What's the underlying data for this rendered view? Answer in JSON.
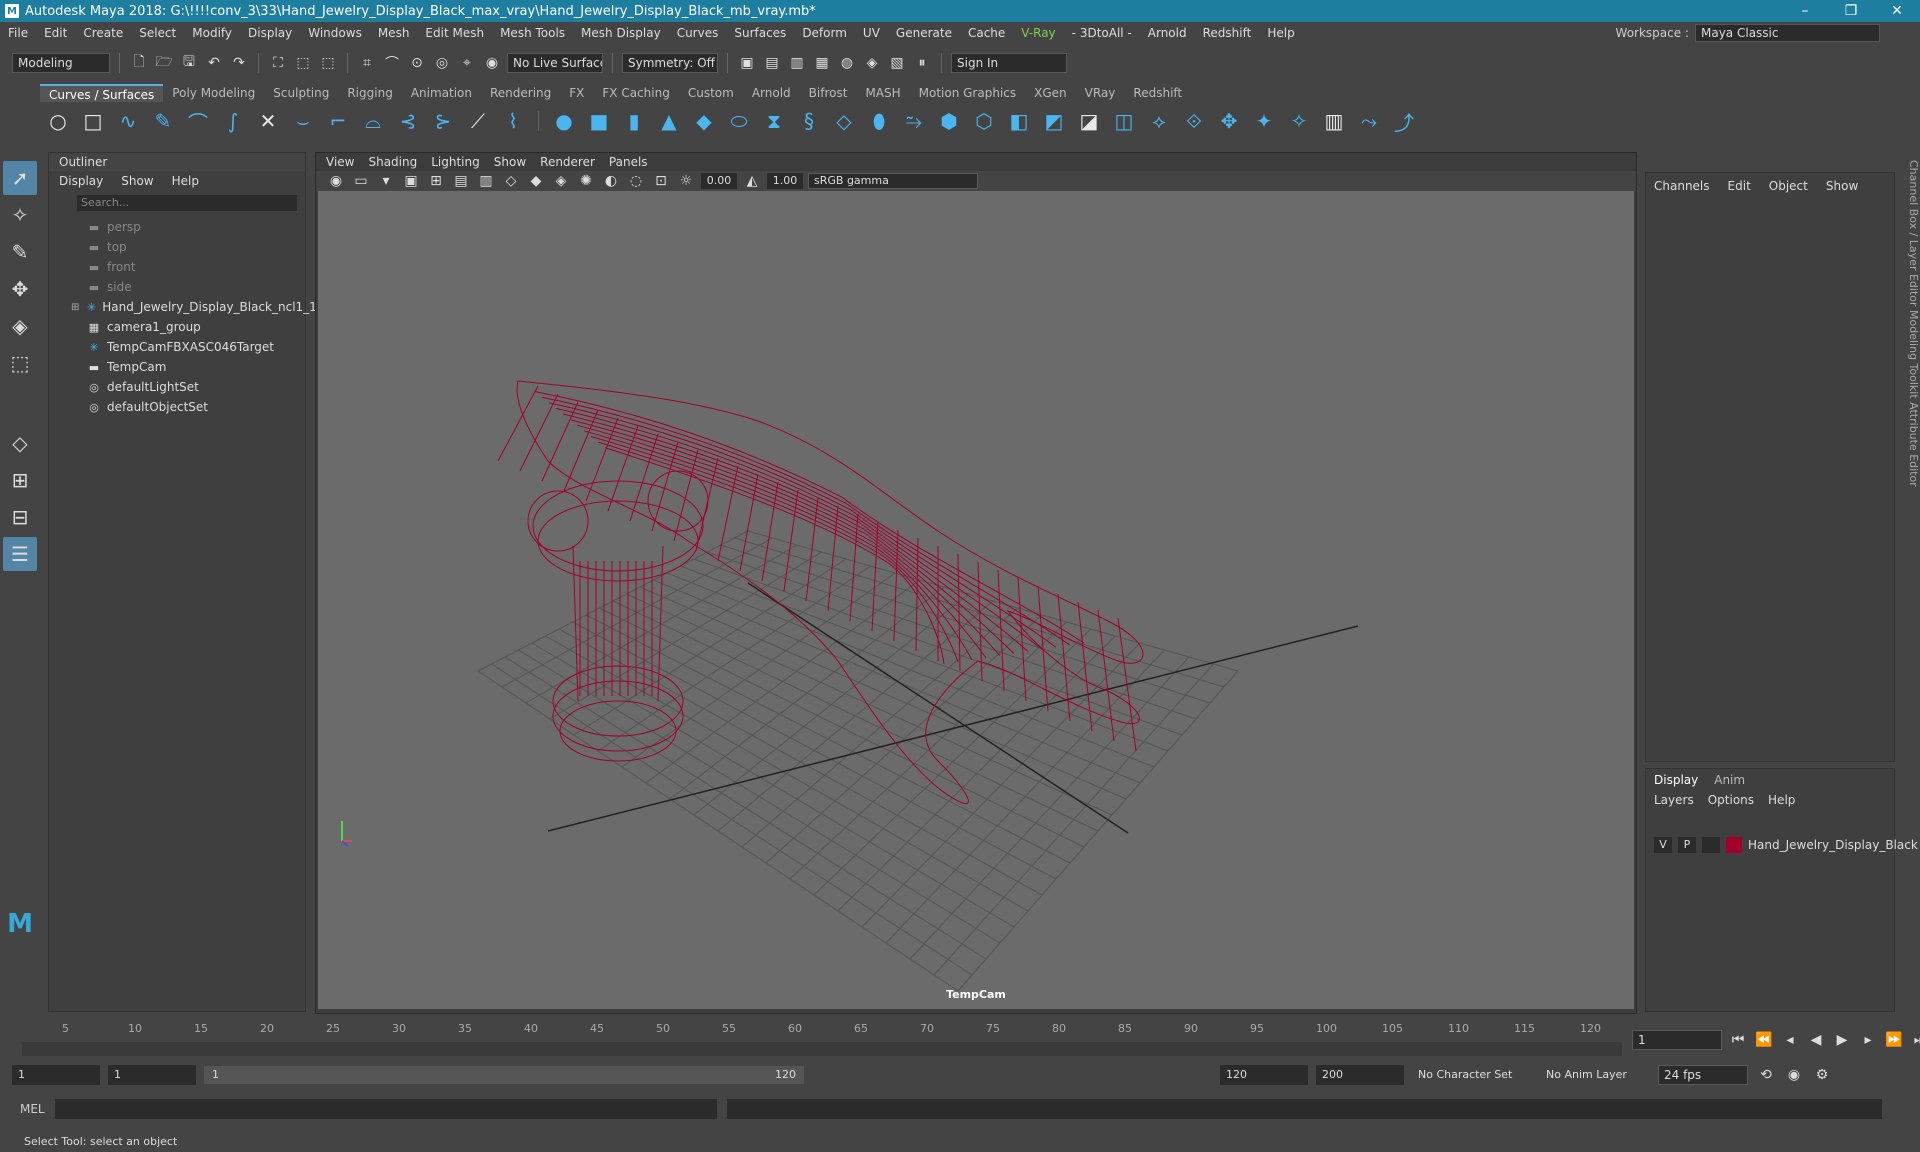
{
  "titlebar": {
    "title": "Autodesk Maya 2018: G:\\!!!!conv_3\\33\\Hand_Jewelry_Display_Black_max_vray\\Hand_Jewelry_Display_Black_mb_vray.mb*",
    "min": "–",
    "max": "❐",
    "close": "✕"
  },
  "menu": [
    "File",
    "Edit",
    "Create",
    "Select",
    "Modify",
    "Display",
    "Windows",
    "Mesh",
    "Edit Mesh",
    "Mesh Tools",
    "Mesh Display",
    "Curves",
    "Surfaces",
    "Deform",
    "UV",
    "Generate",
    "Cache",
    "V-Ray",
    "- 3DtoAll -",
    "Arnold",
    "Redshift",
    "Help"
  ],
  "workspace": {
    "label": "Workspace :",
    "value": "Maya Classic"
  },
  "statusline": {
    "mode": "Modeling",
    "live": "No Live Surface",
    "symmetry": "Symmetry: Off",
    "signin": "Sign In"
  },
  "shelf_tabs": [
    "Curves / Surfaces",
    "Poly Modeling",
    "Sculpting",
    "Rigging",
    "Animation",
    "Rendering",
    "FX",
    "FX Caching",
    "Custom",
    "Arnold",
    "Bifrost",
    "MASH",
    "Motion Graphics",
    "XGen",
    "VRay",
    "Redshift"
  ],
  "outliner": {
    "title": "Outliner",
    "menus": [
      "Display",
      "Show",
      "Help"
    ],
    "search": "Search...",
    "items": [
      {
        "label": "persp",
        "type": "cam"
      },
      {
        "label": "top",
        "type": "cam"
      },
      {
        "label": "front",
        "type": "cam"
      },
      {
        "label": "side",
        "type": "cam"
      },
      {
        "label": "Hand_Jewelry_Display_Black_ncl1_1",
        "type": "group"
      },
      {
        "label": "camera1_group",
        "type": "grp"
      },
      {
        "label": "TempCamFBXASC046Target",
        "type": "target"
      },
      {
        "label": "TempCam",
        "type": "camobj"
      },
      {
        "label": "defaultLightSet",
        "type": "set"
      },
      {
        "label": "defaultObjectSet",
        "type": "set"
      }
    ]
  },
  "viewport": {
    "menus": [
      "View",
      "Shading",
      "Lighting",
      "Show",
      "Renderer",
      "Panels"
    ],
    "exposure": "0.00",
    "gamma": "1.00",
    "colorspace": "sRGB gamma",
    "camera": "TempCam"
  },
  "channelbox": {
    "menus": [
      "Channels",
      "Edit",
      "Object",
      "Show"
    ]
  },
  "layers": {
    "tabs": [
      "Display",
      "Anim"
    ],
    "menus": [
      "Layers",
      "Options",
      "Help"
    ],
    "v": "V",
    "p": "P",
    "layer_name": "Hand_Jewelry_Display_Black",
    "layer_color": "#a0002a"
  },
  "sidetabs": "Channel Box / Layer Editor   Modeling Toolkit   Attribute Editor",
  "timeline": {
    "ticks": [
      "5",
      "10",
      "15",
      "20",
      "25",
      "30",
      "35",
      "40",
      "45",
      "50",
      "55",
      "60",
      "65",
      "70",
      "75",
      "80",
      "85",
      "90",
      "95",
      "100",
      "105",
      "110",
      "115",
      "120"
    ],
    "current": "1",
    "current_field": "1"
  },
  "range": {
    "start": "1",
    "start2": "1",
    "slider_start": "1",
    "slider_end": "120",
    "end": "120",
    "end2": "200",
    "char": "No Character Set",
    "anim": "No Anim Layer",
    "fps": "24 fps"
  },
  "cmd": {
    "label": "MEL"
  },
  "help": "Select Tool: select an object"
}
